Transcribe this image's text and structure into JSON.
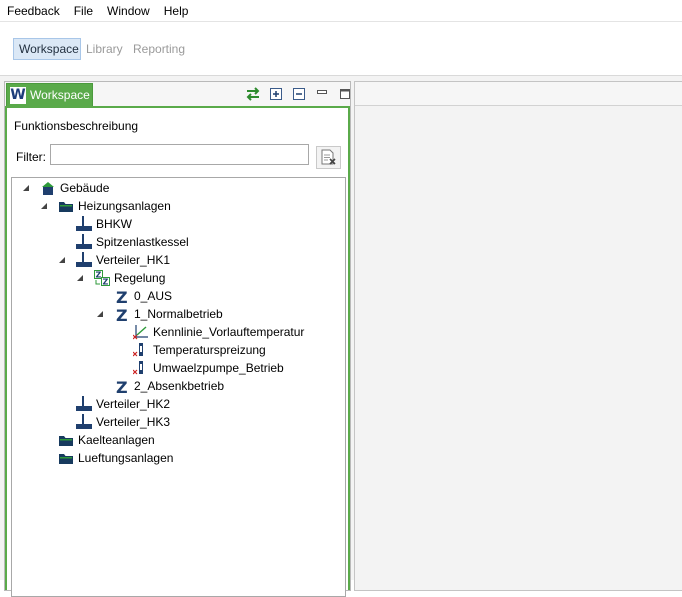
{
  "menu": [
    "Feedback",
    "File",
    "Window",
    "Help"
  ],
  "perspectives": {
    "active": "Workspace",
    "others": [
      "Library",
      "Reporting"
    ]
  },
  "view": {
    "tab_icon_letter": "W",
    "tab_label": "Workspace",
    "title": "Funktionsbeschreibung",
    "filter_label": "Filter:",
    "filter_value": "",
    "tools": [
      "sync-icon",
      "expand-all-icon",
      "collapse-all-icon",
      "minimize-icon",
      "maximize-icon"
    ]
  },
  "tree": [
    {
      "label": "Gebäude",
      "icon": "building-icon",
      "expanded": true
    },
    {
      "label": "Heizungsanlagen",
      "icon": "folder-icon",
      "expanded": true
    },
    {
      "label": "BHKW",
      "icon": "component-icon"
    },
    {
      "label": "Spitzenlastkessel",
      "icon": "component-icon"
    },
    {
      "label": "Verteiler_HK1",
      "icon": "component-icon",
      "expanded": true
    },
    {
      "label": "Regelung",
      "icon": "control-icon",
      "expanded": true
    },
    {
      "label": "0_AUS",
      "icon": "state-icon",
      "letter": "Z"
    },
    {
      "label": "1_Normalbetrieb",
      "icon": "state-icon",
      "letter": "Z",
      "expanded": true
    },
    {
      "label": "Kennlinie_Vorlauftemperatur",
      "icon": "curve-icon"
    },
    {
      "label": "Temperaturspreizung",
      "icon": "parameter-icon"
    },
    {
      "label": "Umwaelzpumpe_Betrieb",
      "icon": "parameter-icon"
    },
    {
      "label": "2_Absenkbetrieb",
      "icon": "state-icon",
      "letter": "Z"
    },
    {
      "label": "Verteiler_HK2",
      "icon": "component-icon"
    },
    {
      "label": "Verteiler_HK3",
      "icon": "component-icon"
    },
    {
      "label": "Kaelteanlagen",
      "icon": "folder-icon"
    },
    {
      "label": "Lueftungsanlagen",
      "icon": "folder-icon"
    }
  ],
  "colors": {
    "accent_green": "#5aaa4a",
    "active_perspective_bg": "#dbe8f6",
    "component_blue": "#1f3f6e"
  }
}
